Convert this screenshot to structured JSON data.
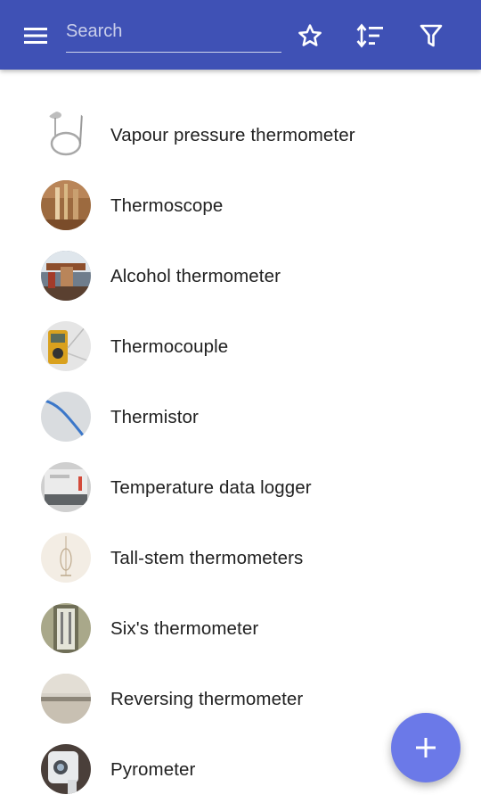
{
  "search": {
    "placeholder": "Search"
  },
  "toolbar": {
    "menu_icon": "hamburger-menu-icon",
    "star_icon": "star-outline-icon",
    "sort_icon": "sort-icon",
    "filter_icon": "filter-icon",
    "accent_color": "#3f51b5"
  },
  "items": [
    {
      "label": "Vapour pressure thermometer",
      "thumb": "vapour-pressure-thermometer-image"
    },
    {
      "label": "Thermoscope",
      "thumb": "thermoscope-image"
    },
    {
      "label": "Alcohol thermometer",
      "thumb": "alcohol-thermometer-image"
    },
    {
      "label": "Thermocouple",
      "thumb": "thermocouple-image"
    },
    {
      "label": "Thermistor",
      "thumb": "thermistor-image"
    },
    {
      "label": "Temperature data logger",
      "thumb": "temperature-data-logger-image"
    },
    {
      "label": "Tall-stem thermometers",
      "thumb": "tall-stem-thermometers-image"
    },
    {
      "label": "Six's thermometer",
      "thumb": "sixs-thermometer-image"
    },
    {
      "label": "Reversing thermometer",
      "thumb": "reversing-thermometer-image"
    },
    {
      "label": "Pyrometer",
      "thumb": "pyrometer-image"
    }
  ],
  "fab": {
    "icon": "plus-icon",
    "color": "#6b79e8"
  }
}
